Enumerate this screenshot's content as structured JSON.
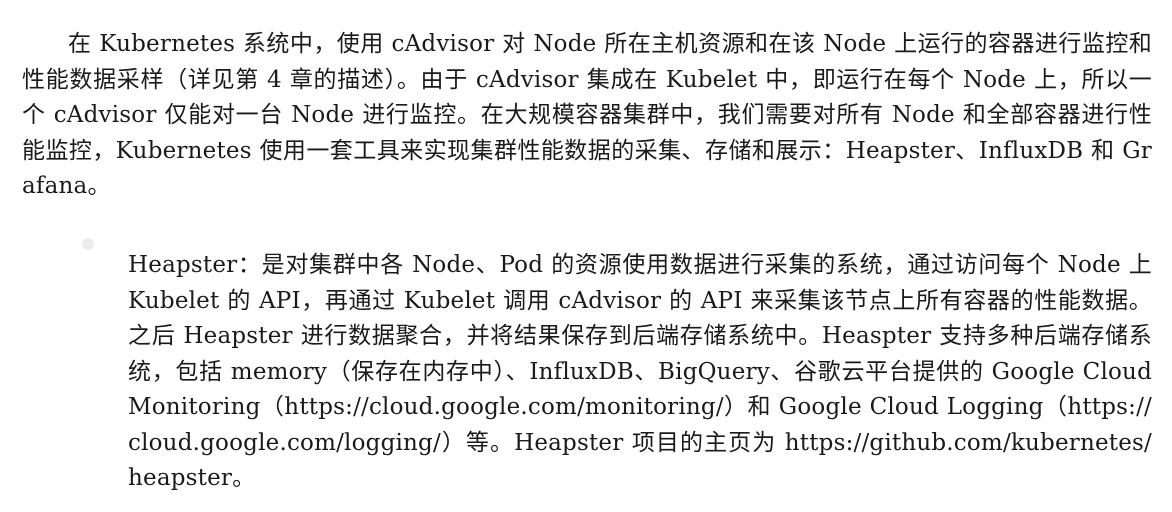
{
  "document": {
    "paragraphs": [
      "在 Kubernetes 系统中，使用 cAdvisor 对 Node 所在主机资源和在该 Node 上运行的容器进行监控和性能数据采样（详见第 4 章的描述）。由于 cAdvisor 集成在 Kubelet 中，即运行在每个 Node 上，所以一个 cAdvisor 仅能对一台 Node 进行监控。在大规模容器集群中，我们需要对所有 Node 和全部容器进行性能监控，Kubernetes 使用一套工具来实现集群性能数据的采集、存储和展示：Heapster、InfluxDB 和 Grafana。"
    ],
    "bullets": [
      {
        "text": "Heapster：是对集群中各 Node、Pod 的资源使用数据进行采集的系统，通过访问每个 Node 上 Kubelet 的 API，再通过 Kubelet 调用 cAdvisor 的 API 来采集该节点上所有容器的性能数据。之后 Heapster 进行数据聚合，并将结果保存到后端存储系统中。Heaspter 支持多种后端存储系统，包括 memory（保存在内存中）、InfluxDB、BigQuery、谷歌云平台提供的 Google Cloud Monitoring（https://cloud.google.com/monitoring/）和 Google Cloud Logging（https://cloud.google.com/logging/）等。Heapster 项目的主页为 https://github.com/kubernetes/heapster。"
      }
    ]
  }
}
